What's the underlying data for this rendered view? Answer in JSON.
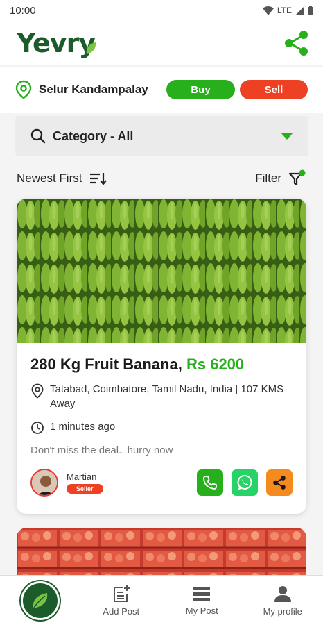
{
  "status": {
    "time": "10:00",
    "network": "LTE"
  },
  "app": {
    "logo": "Yevry"
  },
  "location": {
    "name": "Selur Kandampalay",
    "buy_label": "Buy",
    "sell_label": "Sell"
  },
  "category": {
    "label": "Category - All"
  },
  "sort": {
    "label": "Newest First"
  },
  "filter": {
    "label": "Filter"
  },
  "post": {
    "title": "280 Kg Fruit Banana,",
    "price": "Rs 6200",
    "location": "Tatabad, Coimbatore, Tamil Nadu, India | 107 KMS Away",
    "time": "1 minutes ago",
    "note": "Don't miss the deal.. hurry now",
    "seller_name": "Martian",
    "seller_badge": "Seller"
  },
  "nav": {
    "add_post": "Add Post",
    "my_post": "My Post",
    "my_profile": "My profile"
  },
  "colors": {
    "brand": "#1c5c2a",
    "buy": "#27b01c",
    "sell": "#ee4022",
    "whatsapp": "#25d366",
    "share": "#f58a1f"
  }
}
